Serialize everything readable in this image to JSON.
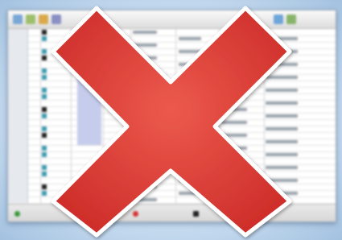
{
  "colors": {
    "x_fill": "#e0413c",
    "x_stroke": "#ffffff",
    "cell_highlight": "#c6ccec",
    "status_ok": "#3a9a3a",
    "status_error": "#d83232",
    "status_black": "#222222"
  },
  "icons": [
    "red-x-icon",
    "toolbar-icons"
  ]
}
